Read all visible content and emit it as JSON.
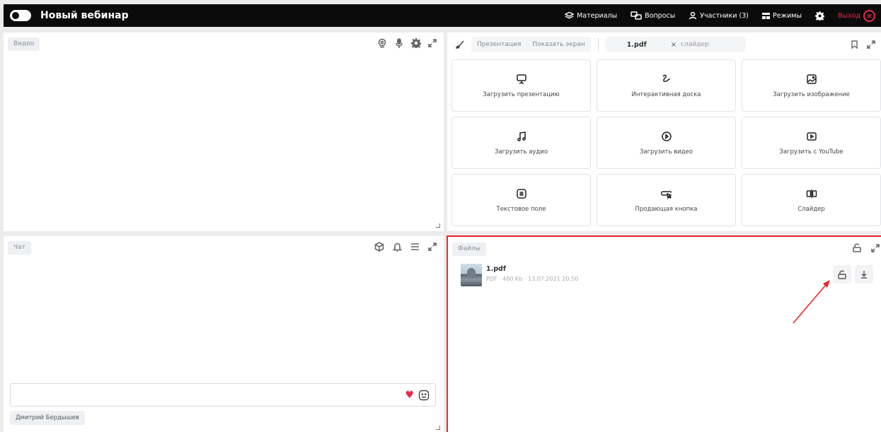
{
  "header": {
    "title": "Новый вебинар",
    "nav": [
      {
        "label": "Материалы",
        "icon": "layers-icon"
      },
      {
        "label": "Вопросы",
        "icon": "chat-bubbles-icon"
      },
      {
        "label": "Участники (3)",
        "icon": "user-icon"
      },
      {
        "label": "Режимы",
        "icon": "grid-icon"
      },
      {
        "label": "",
        "icon": "gear-icon"
      }
    ],
    "exit_label": "Выход",
    "exit_symbol": "×"
  },
  "video": {
    "label": "Видео",
    "icons": [
      "webcam-icon",
      "microphone-icon",
      "gear-icon",
      "expand-icon"
    ]
  },
  "presentation": {
    "tab_presentation": "Презентация",
    "tab_share_screen": "Показать экран",
    "file_tab": "1.pdf",
    "close_symbol": "×",
    "slider_label": "слайдер",
    "cards": [
      {
        "label": "Загрузить презентацию",
        "icon": "presentation-icon"
      },
      {
        "label": "Интерактивная доска",
        "icon": "scribble-icon"
      },
      {
        "label": "Загрузить изображение",
        "icon": "image-icon"
      },
      {
        "label": "Загрузить аудио",
        "icon": "music-note-icon"
      },
      {
        "label": "Загрузить видео",
        "icon": "play-circle-icon"
      },
      {
        "label": "Загрузить с YouTube",
        "icon": "youtube-icon"
      },
      {
        "label": "Текстовое поле",
        "icon": "text-box-icon"
      },
      {
        "label": "Продающая кнопка",
        "icon": "cursor-button-icon"
      },
      {
        "label": "Слайдер",
        "icon": "slider-icon"
      }
    ]
  },
  "chat": {
    "label": "Чат",
    "input_value": "",
    "user_name": "Дмитрий Бердышев",
    "heart": "♥"
  },
  "files": {
    "label": "Файлы",
    "items": [
      {
        "name": "1.pdf",
        "info": "PDF · 480 Kb · 13.07.2021 20:50"
      }
    ]
  },
  "colors": {
    "accent_red": "#e8284a",
    "highlight_border": "#e8282c",
    "topbar": "#0b0b0b"
  }
}
